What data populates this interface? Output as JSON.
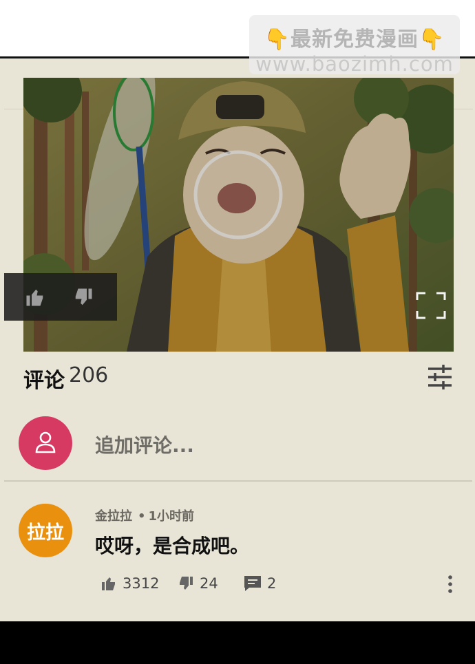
{
  "watermark": {
    "line1": "最新免费漫画",
    "line2": "www.baozimh.com"
  },
  "comments": {
    "title": "评论",
    "count": "206",
    "add_placeholder": "追加评论..."
  },
  "comment": {
    "avatar_text": "拉拉",
    "author": "金拉拉",
    "time": "1小时前",
    "text": "哎呀，是合成吧。",
    "likes": "3312",
    "dislikes": "24",
    "replies": "2"
  },
  "icons": {
    "reaction_like": "thumb-up-icon",
    "reaction_dislike": "thumb-down-icon",
    "fullscreen": "fullscreen-icon",
    "filter": "sliders-icon",
    "user": "user-icon",
    "reply": "comment-icon",
    "more": "more-vertical-icon",
    "hand": "pointing-down-hand-icon"
  },
  "colors": {
    "panel_background": "#e8e4d6",
    "add_avatar": "#d63a63",
    "user_avatar": "#e9900e",
    "watermark_hand": "#f2b61a"
  }
}
